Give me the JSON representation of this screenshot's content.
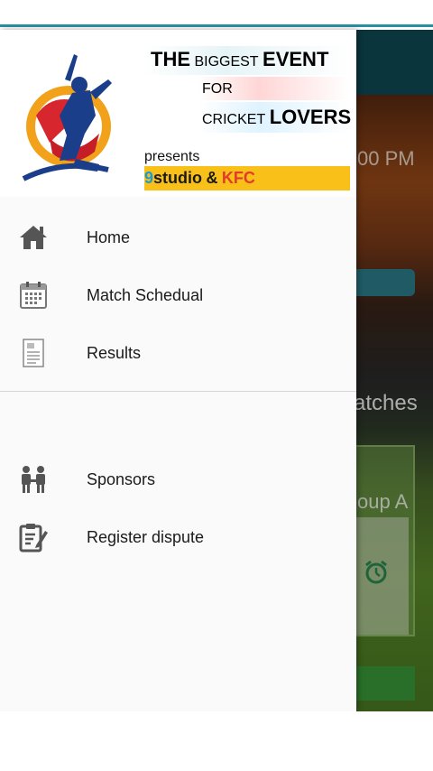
{
  "background": {
    "time_fragment": "00 PM",
    "section_fragment": "atches",
    "group_fragment": "oup A",
    "alarm_icon": "alarm-clock-icon"
  },
  "header": {
    "banner": {
      "the": "THE",
      "biggest": "BIGGEST",
      "event": "EVENT",
      "for": "FOR",
      "cricket": "CRICKET",
      "lovers": "LOVERS",
      "presents": "presents",
      "sponsor_9": "9",
      "sponsor_studio": "studio",
      "sponsor_amp": "&",
      "sponsor_kfc": "KFC"
    },
    "logo_icon": "cricket-batsman-logo"
  },
  "menu": {
    "primary": [
      {
        "label": "Home",
        "icon": "home-icon"
      },
      {
        "label": "Match Schedual",
        "icon": "calendar-icon"
      },
      {
        "label": "Results",
        "icon": "document-icon"
      }
    ],
    "secondary": [
      {
        "label": "Sponsors",
        "icon": "people-icon"
      },
      {
        "label": "Register dispute",
        "icon": "clipboard-edit-icon"
      }
    ]
  },
  "colors": {
    "toolbar": "#0e4a54",
    "accent": "#2a8fa0",
    "sponsor_bar": "#f9c01a",
    "kfc_red": "#e23b2a",
    "nine_blue": "#1a9bd6"
  }
}
